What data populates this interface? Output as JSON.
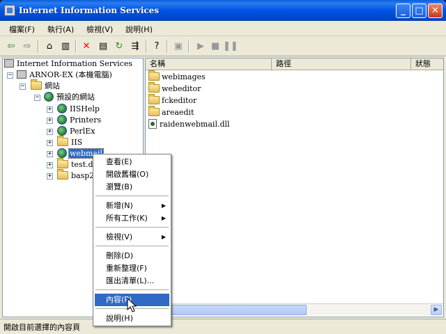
{
  "window": {
    "title": "Internet Information Services"
  },
  "title_buttons": {
    "minimize": "_",
    "maximize": "□",
    "close": "✕"
  },
  "menu": [
    "檔案(F)",
    "執行(A)",
    "檢視(V)",
    "說明(H)"
  ],
  "tree": {
    "root": "Internet Information Services",
    "server": "ARNOR-EX (本機電腦)",
    "sites": "網站",
    "default_site": "預設的網站",
    "items": [
      "IISHelp",
      "Printers",
      "PerlEx",
      "IIS",
      "webmail",
      "test.dll",
      "basp2"
    ]
  },
  "list": {
    "columns": [
      "名稱",
      "路徑",
      "狀態"
    ],
    "rows": [
      "webimages",
      "webeditor",
      "fckeditor",
      "areaedit",
      "raidenwebmail.dll"
    ]
  },
  "context_menu": {
    "items": [
      "查看(E)",
      "開啟舊檔(O)",
      "瀏覽(B)",
      "新增(N)",
      "所有工作(K)",
      "檢視(V)",
      "刪除(D)",
      "重新整理(F)",
      "匯出清單(L)...",
      "內容(P)",
      "說明(H)"
    ]
  },
  "status": {
    "text": "開啟目前選擇的內容頁"
  }
}
